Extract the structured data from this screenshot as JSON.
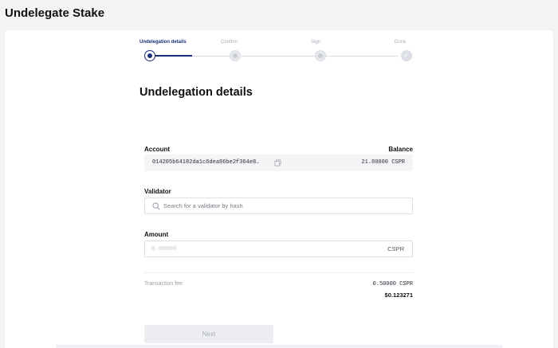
{
  "page": {
    "title": "Undelegate Stake"
  },
  "stepper": {
    "steps": [
      {
        "label": "Undelegation details",
        "state": "active"
      },
      {
        "label": "Confirm",
        "state": "pending"
      },
      {
        "label": "Sign",
        "state": "pending"
      },
      {
        "label": "Done",
        "state": "done"
      }
    ]
  },
  "form": {
    "section_title": "Undelegation details",
    "account": {
      "label": "Account",
      "balance_label": "Balance",
      "hash": "014205b64182da1c6dea86be2f364e8…",
      "balance": "21.80000 CSPR"
    },
    "validator": {
      "label": "Validator",
      "placeholder": "Search for a validator by hash",
      "value": ""
    },
    "amount": {
      "label": "Amount",
      "placeholder": "0.00000",
      "value": "",
      "unit": "CSPR"
    },
    "fee": {
      "label": "Transaction fee",
      "cspr": "0.50000 CSPR",
      "usd": "$0.123271"
    },
    "next_label": "Next"
  },
  "colors": {
    "accent": "#1a2f7a",
    "background": "#f2f3f5",
    "card": "#ffffff",
    "muted_text": "#9a9da8"
  },
  "icons": {
    "copy": "copy-icon",
    "search": "search-icon",
    "check": "check-icon"
  }
}
